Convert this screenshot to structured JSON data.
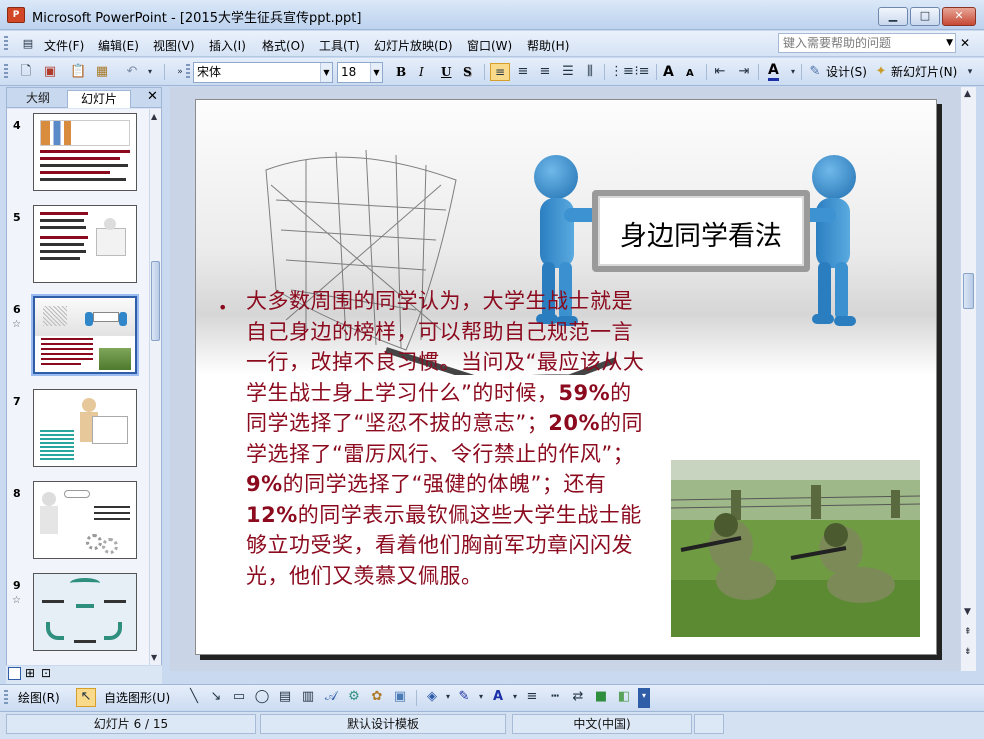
{
  "window": {
    "app_icon": "P",
    "title": "Microsoft PowerPoint - [2015大学生征兵宣传ppt.ppt]",
    "minimize": "▁",
    "maximize": "□",
    "close": "✕"
  },
  "menu": {
    "items": [
      "文件(F)",
      "编辑(E)",
      "视图(V)",
      "插入(I)",
      "格式(O)",
      "工具(T)",
      "幻灯片放映(D)",
      "窗口(W)",
      "帮助(H)"
    ],
    "help_placeholder": "键入需要帮助的问题",
    "close_doc": "✕"
  },
  "toolbar": {
    "font_name": "宋体",
    "font_size": "18",
    "bold": "B",
    "italic": "I",
    "underline": "U",
    "shadow": "S",
    "font_color": "A",
    "design_label": "设计(S)",
    "new_slide_label": "新幻灯片(N)",
    "increase_font": "A",
    "decrease_font": "A"
  },
  "left_panel": {
    "tab_outline": "大纲",
    "tab_slides": "幻灯片",
    "close": "✕",
    "slides": [
      {
        "num": "4"
      },
      {
        "num": "5"
      },
      {
        "num": "6",
        "selected": true,
        "star": "☆"
      },
      {
        "num": "7"
      },
      {
        "num": "8"
      },
      {
        "num": "9",
        "star": "☆"
      }
    ]
  },
  "slide": {
    "sign_text": "身边同学看法",
    "bullet": "•",
    "body": {
      "p1": "大多数周围的同学认为，大学生战士就是自己身边的榜样，可以帮助自己规范一言一行，改掉不良习惯。当问及“最应该从大学生战士身上学习什么”的时候，",
      "pct1": "59%",
      "p2": "的同学选择了“坚忍不拔的意志”；",
      "pct2": "20%",
      "p3": "的同学选择了“雷厉风行、令行禁止的作风”；",
      "pct3": "9%",
      "p4": "的同学选择了“强健的体魄”；还有",
      "pct4": "12%",
      "p5": "的同学表示最钦佩这些大学生战士能够立功受奖，看着他们胸前军功章闪闪发光，他们又羡慕又佩服。"
    }
  },
  "draw_toolbar": {
    "draw_label": "绘图(R)",
    "autoshape_label": "自选图形(U)"
  },
  "status": {
    "slide_pos": "幻灯片 6 / 15",
    "template": "默认设计模板",
    "language": "中文(中国)"
  },
  "colors": {
    "body_text": "#8b0a1e",
    "figure_blue": "#2f86c9"
  }
}
